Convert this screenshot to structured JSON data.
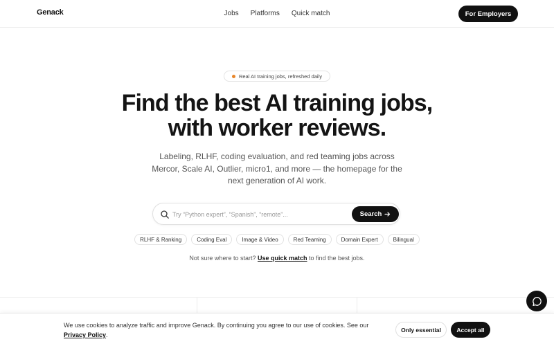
{
  "header": {
    "brand": "Genack",
    "nav": [
      "Jobs",
      "Platforms",
      "Quick match"
    ],
    "cta_label": "For Employers"
  },
  "hero": {
    "pill_text": "Real AI training jobs, refreshed daily",
    "headline_line1": "Find the best AI training jobs,",
    "headline_line2": "with worker reviews.",
    "subtext": "Labeling, RLHF, coding evaluation, and red teaming jobs across Mercor, Scale AI, Outlier, micro1, and more — the homepage for the next generation of AI work."
  },
  "search": {
    "placeholder": "Try “Python expert”, “Spanish”, “remote”...",
    "value": "",
    "button_label": "Search",
    "icon": "search-icon"
  },
  "chips": [
    "RLHF & Ranking",
    "Coding Eval",
    "Image & Video",
    "Red Teaming",
    "Domain Expert",
    "Bilingual"
  ],
  "hint": {
    "prefix": "Not sure where to start? ",
    "link": "Use quick match",
    "suffix": " to find the best jobs."
  },
  "cookie": {
    "text": "We use cookies to analyze traffic and improve Genack. By continuing you agree to our use of cookies. See our ",
    "link": "Privacy Policy",
    "suffix": ".",
    "essential_label": "Only essential",
    "accept_label": "Accept all"
  },
  "colors": {
    "accent": "#111111",
    "pill_dot": "#e8862a",
    "border": "#e3e3e3"
  }
}
